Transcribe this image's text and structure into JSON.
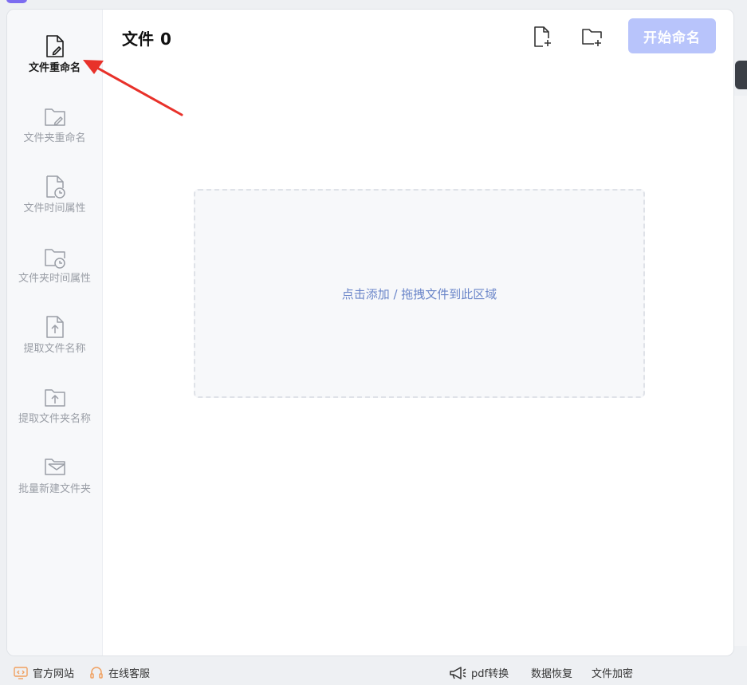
{
  "header": {
    "title": "文件",
    "count": "0",
    "start_label": "开始命名"
  },
  "sidebar": {
    "items": [
      {
        "label": "文件重命名",
        "icon": "file-edit-icon",
        "active": true
      },
      {
        "label": "文件夹重命名",
        "icon": "folder-edit-icon"
      },
      {
        "label": "文件时间属性",
        "icon": "file-clock-icon"
      },
      {
        "label": "文件夹时间属性",
        "icon": "folder-clock-icon"
      },
      {
        "label": "提取文件名称",
        "icon": "file-upload-icon"
      },
      {
        "label": "提取文件夹名称",
        "icon": "folder-upload-icon"
      },
      {
        "label": "批量新建文件夹",
        "icon": "folder-mail-icon"
      }
    ]
  },
  "toolbar": {
    "add_file_icon": "file-plus-icon",
    "add_folder_icon": "folder-plus-icon"
  },
  "dropzone": {
    "hint": "点击添加 / 拖拽文件到此区域"
  },
  "footer": {
    "official_site": "官方网站",
    "online_service": "在线客服",
    "pdf_convert": "pdf转换",
    "data_recovery": "数据恢复",
    "file_encrypt": "文件加密"
  },
  "colors": {
    "accent": "#b8c4fb",
    "hint": "#6b86c9",
    "arrow": "#e8312a",
    "footer_icon": "#f0a060"
  }
}
